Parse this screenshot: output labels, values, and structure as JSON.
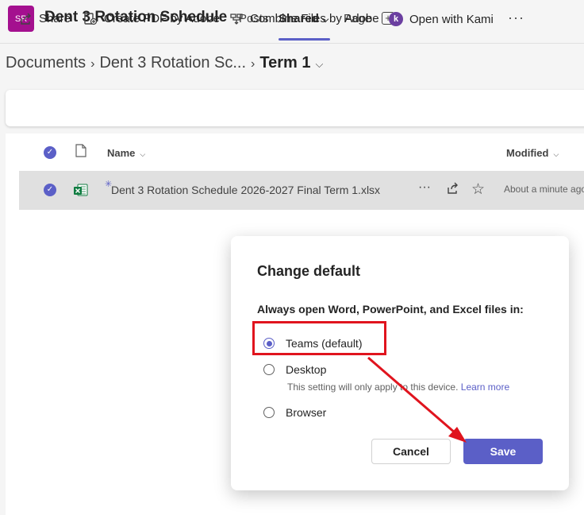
{
  "header": {
    "avatar_initials": "SR",
    "team_title": "Dent 3 Rotation Schedule",
    "tabs": [
      {
        "label": "Posts"
      },
      {
        "label": "Shared"
      },
      {
        "label": "Page"
      }
    ]
  },
  "breadcrumb": {
    "items": [
      "Documents",
      "Dent 3 Rotation Sc...",
      "Term 1"
    ]
  },
  "commands": {
    "share": "Share",
    "create_pdf": "Create PDF by Adobe",
    "combine": "Combine Files by Adobe",
    "kami_icon_letter": "k",
    "open_kami": "Open with Kami",
    "more": "···"
  },
  "list": {
    "col_name": "Name",
    "col_modified": "Modified",
    "rows": [
      {
        "name": "Dent 3 Rotation Schedule 2026-2027 Final Term 1.xlsx",
        "modified": "About a minute ago"
      }
    ]
  },
  "dialog": {
    "title": "Change default",
    "subtitle": "Always open Word, PowerPoint, and Excel files in:",
    "options": [
      {
        "label": "Teams (default)",
        "selected": true
      },
      {
        "label": "Desktop",
        "selected": false
      },
      {
        "label": "Browser",
        "selected": false
      }
    ],
    "hint": "This setting will only apply to this device.",
    "learn_more": "Learn more",
    "cancel": "Cancel",
    "save": "Save"
  },
  "colors": {
    "accent": "#5b5fc7",
    "annotation": "#e0141e",
    "avatar": "#a4108f"
  }
}
